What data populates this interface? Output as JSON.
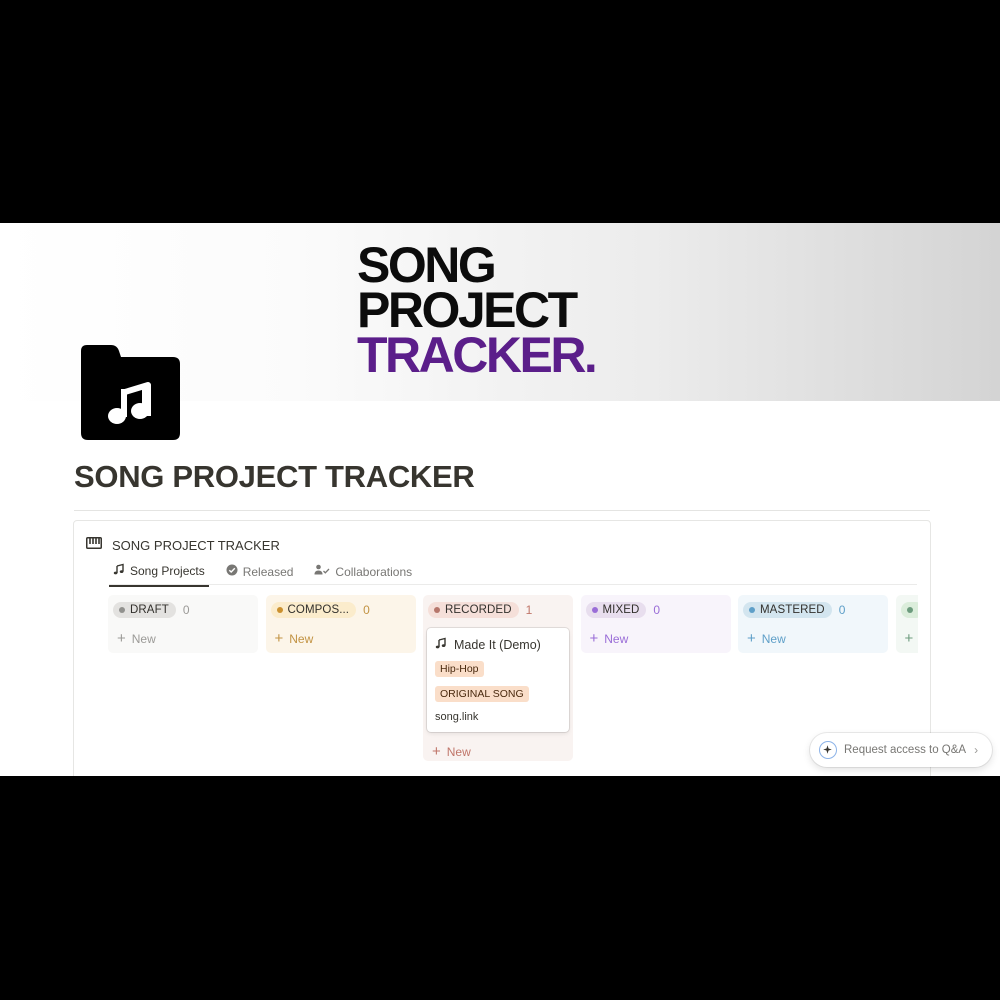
{
  "cover": {
    "line1": "SONG",
    "line2": "PROJECT",
    "line3": "TRACKER."
  },
  "page": {
    "title": "SONG PROJECT TRACKER",
    "icon": "music-folder-icon"
  },
  "database": {
    "icon": "piano-icon",
    "title": "SONG PROJECT TRACKER",
    "tabs": [
      {
        "label": "Song Projects",
        "icon": "music-note-icon",
        "active": true
      },
      {
        "label": "Released",
        "icon": "check-circle-icon",
        "active": false
      },
      {
        "label": "Collaborations",
        "icon": "people-check-icon",
        "active": false
      }
    ]
  },
  "board": {
    "new_label": "New",
    "columns": [
      {
        "name": "DRAFT",
        "count": "0",
        "bg": "#f9f9f8",
        "pill_bg": "#e3e2e0",
        "dot": "#91918e",
        "text": "#9b9a97"
      },
      {
        "name": "COMPOS...",
        "count": "0",
        "bg": "#fcf5e9",
        "pill_bg": "#fbeccc",
        "dot": "#cb912f",
        "text": "#c29343"
      },
      {
        "name": "RECORDED",
        "count": "1",
        "bg": "#f9f3f1",
        "pill_bg": "#f5dfd9",
        "dot": "#b6766b",
        "text": "#c0766a"
      },
      {
        "name": "MIXED",
        "count": "0",
        "bg": "#f8f4fb",
        "pill_bg": "#e8deee",
        "dot": "#9a6dd7",
        "text": "#9a6dd7"
      },
      {
        "name": "MASTERED",
        "count": "0",
        "bg": "#f1f7fb",
        "pill_bg": "#d3e5ef",
        "dot": "#5e9fc8",
        "text": "#5e9fc8"
      },
      {
        "name": "",
        "count": "",
        "bg": "#f3f8f4",
        "pill_bg": "#dbeddb",
        "dot": "#6c9b7d",
        "text": "#6c9b7d"
      }
    ],
    "card": {
      "icon": "music-note-icon",
      "title": "Made It (Demo)",
      "tags": [
        "Hip-Hop",
        "ORIGINAL SONG"
      ],
      "link": "song.link"
    }
  },
  "qa": {
    "label": "Request access to Q&A",
    "icon": "sparkle-icon"
  }
}
